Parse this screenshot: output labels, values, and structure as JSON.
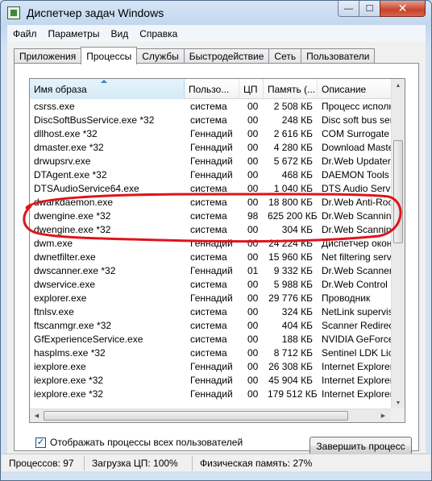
{
  "window": {
    "title": "Диспетчер задач Windows",
    "min_glyph": "—",
    "max_glyph": "☐",
    "close_glyph": "✕"
  },
  "menu": [
    "Файл",
    "Параметры",
    "Вид",
    "Справка"
  ],
  "tabs": [
    {
      "label": "Приложения",
      "active": false
    },
    {
      "label": "Процессы",
      "active": true
    },
    {
      "label": "Службы",
      "active": false
    },
    {
      "label": "Быстродействие",
      "active": false
    },
    {
      "label": "Сеть",
      "active": false
    },
    {
      "label": "Пользователи",
      "active": false
    }
  ],
  "columns": [
    "Имя образа",
    "Пользо...",
    "ЦП",
    "Память (...",
    "Описание"
  ],
  "rows": [
    {
      "name": "csrss.exe",
      "user": "система",
      "cpu": "00",
      "mem": "2 508 КБ",
      "desc": "Процесс исполне"
    },
    {
      "name": "DiscSoftBusService.exe *32",
      "user": "система",
      "cpu": "00",
      "mem": "248 КБ",
      "desc": "Disc soft bus serv"
    },
    {
      "name": "dllhost.exe *32",
      "user": "Геннадий",
      "cpu": "00",
      "mem": "2 616 КБ",
      "desc": "COM Surrogate"
    },
    {
      "name": "dmaster.exe *32",
      "user": "Геннадий",
      "cpu": "00",
      "mem": "4 280 КБ",
      "desc": "Download Master"
    },
    {
      "name": "drwupsrv.exe",
      "user": "Геннадий",
      "cpu": "00",
      "mem": "5 672 КБ",
      "desc": "Dr.Web Updater"
    },
    {
      "name": "DTAgent.exe *32",
      "user": "Геннадий",
      "cpu": "00",
      "mem": "468 КБ",
      "desc": "DAEMON Tools Ult"
    },
    {
      "name": "DTSAudioService64.exe",
      "user": "система",
      "cpu": "00",
      "mem": "1 040 КБ",
      "desc": "DTS Audio Service"
    },
    {
      "name": "dwarkdaemon.exe",
      "user": "система",
      "cpu": "00",
      "mem": "18 800 КБ",
      "desc": "Dr.Web Anti-Root"
    },
    {
      "name": "dwengine.exe *32",
      "user": "система",
      "cpu": "98",
      "mem": "625 200 КБ",
      "desc": "Dr.Web Scanning"
    },
    {
      "name": "dwengine.exe *32",
      "user": "система",
      "cpu": "00",
      "mem": "304 КБ",
      "desc": "Dr.Web Scanning"
    },
    {
      "name": "dwm.exe",
      "user": "Геннадий",
      "cpu": "00",
      "mem": "24 224 КБ",
      "desc": "Диспетчер окон"
    },
    {
      "name": "dwnetfilter.exe",
      "user": "система",
      "cpu": "00",
      "mem": "15 960 КБ",
      "desc": "Net filtering servi"
    },
    {
      "name": "dwscanner.exe *32",
      "user": "Геннадий",
      "cpu": "01",
      "mem": "9 332 КБ",
      "desc": "Dr.Web Scanner S"
    },
    {
      "name": "dwservice.exe",
      "user": "система",
      "cpu": "00",
      "mem": "5 988 КБ",
      "desc": "Dr.Web Control S"
    },
    {
      "name": "explorer.exe",
      "user": "Геннадий",
      "cpu": "00",
      "mem": "29 776 КБ",
      "desc": "Проводник"
    },
    {
      "name": "ftnlsv.exe",
      "user": "система",
      "cpu": "00",
      "mem": "324 КБ",
      "desc": "NetLink supervisor"
    },
    {
      "name": "ftscanmgr.exe *32",
      "user": "система",
      "cpu": "00",
      "mem": "404 КБ",
      "desc": "Scanner Redirecti"
    },
    {
      "name": "GfExperienceService.exe",
      "user": "система",
      "cpu": "00",
      "mem": "188 КБ",
      "desc": "NVIDIA GeForce E"
    },
    {
      "name": "hasplms.exe *32",
      "user": "система",
      "cpu": "00",
      "mem": "8 712 КБ",
      "desc": "Sentinel LDK Licen"
    },
    {
      "name": "iexplore.exe",
      "user": "Геннадий",
      "cpu": "00",
      "mem": "26 308 КБ",
      "desc": "Internet Explorer"
    },
    {
      "name": "iexplore.exe *32",
      "user": "Геннадий",
      "cpu": "00",
      "mem": "45 904 КБ",
      "desc": "Internet Explorer"
    },
    {
      "name": "iexplore.exe *32",
      "user": "Геннадий",
      "cpu": "00",
      "mem": "179 512 КБ",
      "desc": "Internet Explorer"
    }
  ],
  "show_all_label": "Отображать процессы всех пользователей",
  "show_all_checked": true,
  "end_process_label": "Завершить процесс",
  "status": {
    "processes": "Процессов: 97",
    "cpu": "Загрузка ЦП: 100%",
    "memory": "Физическая память: 27%"
  },
  "colors": {
    "highlight_ring": "#e0141a"
  }
}
